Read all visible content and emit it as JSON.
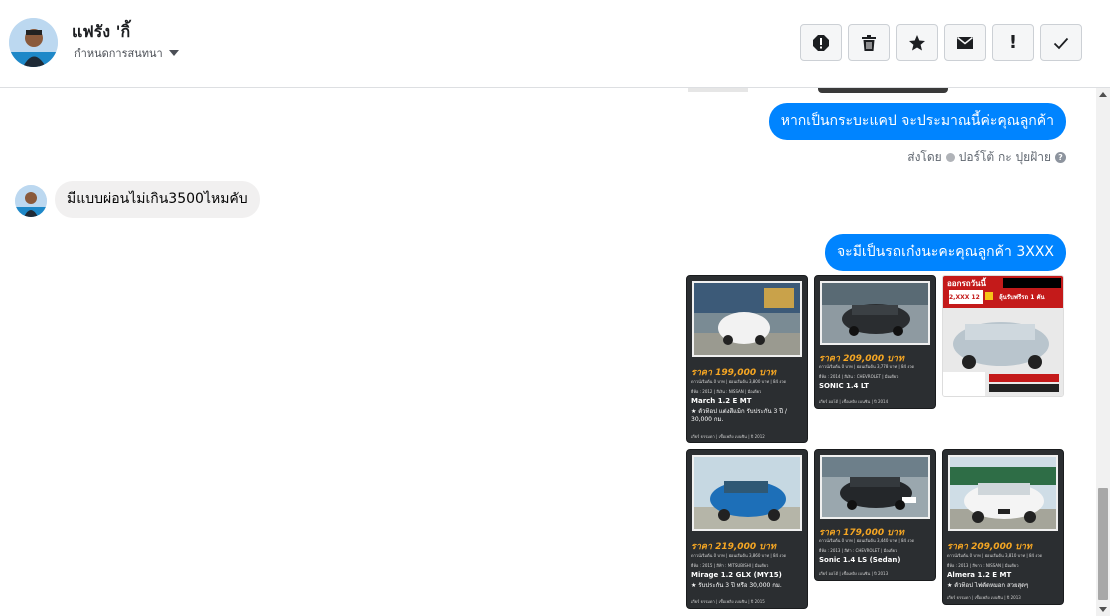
{
  "header": {
    "name": "แฟรัง 'กิ้",
    "sub_label": "กำหนดการสนทนา"
  },
  "actions": [
    {
      "name": "report-icon"
    },
    {
      "name": "trash-icon"
    },
    {
      "name": "star-icon"
    },
    {
      "name": "mail-icon"
    },
    {
      "name": "important-icon",
      "label": "!"
    },
    {
      "name": "checkmark-icon"
    }
  ],
  "messages": {
    "out1": "หากเป็นกระบะแคป จะประมาณนี้ค่ะคุณลูกค้า",
    "sent_by": "ส่งโดย",
    "sender": "ปอร์โต้ กะ ปุยฝ้าย",
    "in1": "มีแบบผ่อนไม่เกิน3500ไหมคับ",
    "out2": "จะมีเป็นรถเก๋งนะคะคุณลูกค้า 3XXX"
  },
  "cards": [
    {
      "price": "ราคา 199,000 บาท",
      "model": "March 1.2 E MT",
      "promo": "★ ตัวท็อป แต่งสีแม็ก รับประกัน 3 ปี / 30,000 กม.",
      "foot_year": "2012"
    },
    {
      "price": "ราคา 209,000 บาท",
      "model": "SONIC 1.4 LT",
      "promo": "",
      "foot_year": "2014"
    },
    {
      "price": "ราคา 219,000 บาท",
      "model": "Mirage 1.2 GLX (MY15)",
      "promo": "★ รับประกัน 3 ปี หรือ 30,000 กม.",
      "foot_year": "2015"
    },
    {
      "price": "ราคา 179,000 บาท",
      "model": "Sonic 1.4 LS (Sedan)",
      "promo": "",
      "foot_year": "2013"
    },
    {
      "price": "ราคา 209,000 บาท",
      "model": "Almera 1.2 E MT",
      "promo": "★ ตัวท็อป ไฟตัดหมอก สวยสุดๆ",
      "foot_year": "2013"
    }
  ],
  "ad": {
    "headline": "ออกรถวันนี้",
    "subline": "ลุ้นรับฟรีรถ 1 คัน",
    "badge": "2,XXX 12"
  },
  "colors": {
    "accent": "#0084ff",
    "price": "#f5a623"
  }
}
